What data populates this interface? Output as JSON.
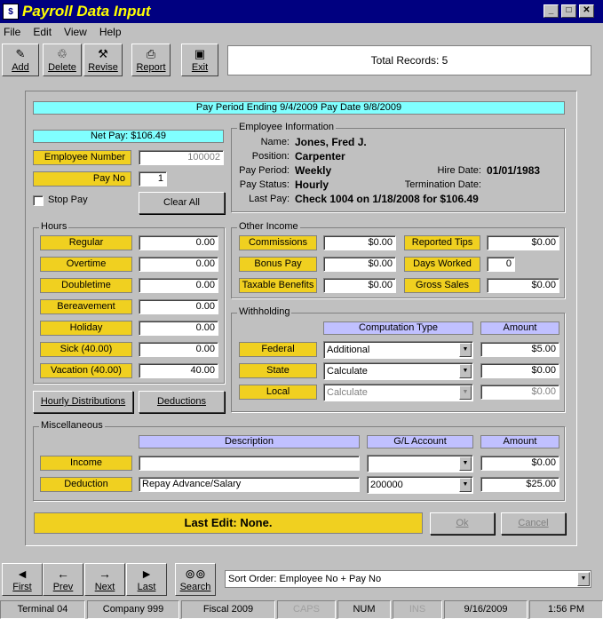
{
  "window": {
    "title": "Payroll Data Input"
  },
  "menu": [
    "File",
    "Edit",
    "View",
    "Help"
  ],
  "toolbar": {
    "add": "Add",
    "delete": "Delete",
    "revise": "Revise",
    "report": "Report",
    "exit": "Exit"
  },
  "total_records": "Total Records: 5",
  "period_banner": "Pay Period Ending 9/4/2009 Pay Date 9/8/2009",
  "net_pay": "Net Pay: $106.49",
  "employee_number": {
    "label": "Employee Number",
    "value": "100002"
  },
  "pay_no": {
    "label": "Pay No",
    "value": "1"
  },
  "stop_pay": "Stop Pay",
  "clear_all": "Clear All",
  "employee_info": {
    "title": "Employee Information",
    "name_label": "Name:",
    "name": "Jones, Fred J.",
    "position_label": "Position:",
    "position": "Carpenter",
    "pay_period_label": "Pay Period:",
    "pay_period": "Weekly",
    "hire_date_label": "Hire Date:",
    "hire_date": "01/01/1983",
    "pay_status_label": "Pay Status:",
    "pay_status": "Hourly",
    "termination_label": "Termination Date:",
    "last_pay_label": "Last Pay:",
    "last_pay": "Check 1004 on 1/18/2008 for $106.49"
  },
  "hours": {
    "title": "Hours",
    "rows": [
      {
        "label": "Regular",
        "value": "0.00"
      },
      {
        "label": "Overtime",
        "value": "0.00"
      },
      {
        "label": "Doubletime",
        "value": "0.00"
      },
      {
        "label": "Bereavement",
        "value": "0.00"
      },
      {
        "label": "Holiday",
        "value": "0.00"
      },
      {
        "label": "Sick (40.00)",
        "value": "0.00"
      },
      {
        "label": "Vacation (40.00)",
        "value": "40.00"
      }
    ]
  },
  "other_income": {
    "title": "Other Income",
    "commissions": {
      "label": "Commissions",
      "value": "$0.00"
    },
    "bonus_pay": {
      "label": "Bonus Pay",
      "value": "$0.00"
    },
    "taxable_benefits": {
      "label": "Taxable Benefits",
      "value": "$0.00"
    },
    "reported_tips": {
      "label": "Reported Tips",
      "value": "$0.00"
    },
    "days_worked": {
      "label": "Days Worked",
      "value": "0"
    },
    "gross_sales": {
      "label": "Gross Sales",
      "value": "$0.00"
    }
  },
  "withholding": {
    "title": "Withholding",
    "col_type": "Computation Type",
    "col_amount": "Amount",
    "federal": {
      "label": "Federal",
      "type": "Additional",
      "amount": "$5.00"
    },
    "state": {
      "label": "State",
      "type": "Calculate",
      "amount": "$0.00"
    },
    "local": {
      "label": "Local",
      "type": "Calculate",
      "amount": "$0.00"
    }
  },
  "buttons": {
    "hourly": "Hourly Distributions",
    "deductions": "Deductions",
    "ok": "Ok",
    "cancel": "Cancel"
  },
  "misc": {
    "title": "Miscellaneous",
    "col_desc": "Description",
    "col_gl": "G/L Account",
    "col_amount": "Amount",
    "income": {
      "label": "Income",
      "desc": "",
      "gl": "",
      "amount": "$0.00"
    },
    "deduction": {
      "label": "Deduction",
      "desc": "Repay Advance/Salary",
      "gl": "200000",
      "amount": "$25.00"
    }
  },
  "last_edit": "Last Edit: None.",
  "nav": {
    "first": "First",
    "prev": "Prev",
    "next": "Next",
    "last": "Last",
    "search": "Search"
  },
  "sort_order": "Sort Order: Employee No + Pay No",
  "status": {
    "terminal": "Terminal 04",
    "company": "Company 999",
    "fiscal": "Fiscal 2009",
    "caps": "CAPS",
    "num": "NUM",
    "ins": "INS",
    "date": "9/16/2009",
    "time": "1:56 PM"
  }
}
